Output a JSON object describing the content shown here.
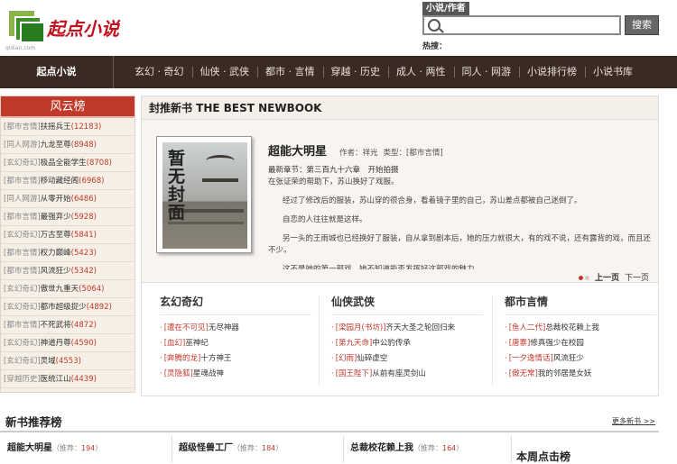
{
  "header": {
    "logo_text": "起点小说",
    "logo_sub": "qidian.com",
    "search_tab": "小说/作者",
    "search_value": "",
    "search_btn": "搜索",
    "hot_label": "热搜："
  },
  "nav": {
    "home": "起点小说",
    "items": [
      "玄幻 · 奇幻",
      "仙侠 · 武侠",
      "都市 · 言情",
      "穿越 · 历史",
      "成人 · 两性",
      "同人 · 网游",
      "小说排行榜",
      "小说书库"
    ]
  },
  "rank": {
    "title": "风云榜",
    "items": [
      {
        "cat": "[都市言情]",
        "name": "扶摇兵王",
        "votes": "(12183)"
      },
      {
        "cat": "[同人网游]",
        "name": "九龙至尊",
        "votes": "(8948)"
      },
      {
        "cat": "[玄幻奇幻]",
        "name": "极品全能学生",
        "votes": "(8708)"
      },
      {
        "cat": "[都市言情]",
        "name": "移动藏经阁",
        "votes": "(6968)"
      },
      {
        "cat": "[同人网游]",
        "name": "从零开始",
        "votes": "(6486)"
      },
      {
        "cat": "[都市言情]",
        "name": "最强弃少",
        "votes": "(5928)"
      },
      {
        "cat": "[玄幻奇幻]",
        "name": "万古至尊",
        "votes": "(5841)"
      },
      {
        "cat": "[都市言情]",
        "name": "权力巅峰",
        "votes": "(5423)"
      },
      {
        "cat": "[都市言情]",
        "name": "风流狂少",
        "votes": "(5342)"
      },
      {
        "cat": "[玄幻奇幻]",
        "name": "傲世九重天",
        "votes": "(5064)"
      },
      {
        "cat": "[玄幻奇幻]",
        "name": "都市超级捉少",
        "votes": "(4892)"
      },
      {
        "cat": "[都市言情]",
        "name": "不死武将",
        "votes": "(4872)"
      },
      {
        "cat": "[玄幻奇幻]",
        "name": "神道丹尊",
        "votes": "(4590)"
      },
      {
        "cat": "[玄幻奇幻]",
        "name": "灵域",
        "votes": "(4553)"
      },
      {
        "cat": "[穿越历史]",
        "name": "医统江山",
        "votes": "(4439)"
      }
    ]
  },
  "featured": {
    "title": "封推新书 THE BEST NEWBOOK",
    "cover_text": "暂无封面",
    "book_name": "超能大明星",
    "author_label": "作者：祥光",
    "type_label": "类型：[都市言情]",
    "latest": "最新章节：第三百九十六章　开始拍摄",
    "p1": "在张证荣的帮助下，苏山换好了戏服。",
    "p2": "经过了修改后的服装，苏山穿的很合身，看着镜子里的自己，苏山差点都被自己迷倒了。",
    "p3": "自恋的人往往就是这样。",
    "p4": "另一头的王雨城也已经换好了服装，自从拿到剧本后，她的压力就很大，有的戏不说，还有露背的戏，而且还不少。",
    "p5": "这不是她的第一部戏，她不知道能否发挥好这部戏的魅力",
    "prev": "上一页",
    "next": "下一页"
  },
  "cats": [
    {
      "title": "玄幻奇幻",
      "items": [
        {
          "tag": "[遭在不可见]",
          "title": "无尽神器"
        },
        {
          "tag": "[血幻]",
          "title": "巫神纪"
        },
        {
          "tag": "[奔腾的龙]",
          "title": "十方神王"
        },
        {
          "tag": "[灵隐狐]",
          "title": "星魂战神"
        }
      ]
    },
    {
      "title": "仙侠武侠",
      "items": [
        {
          "tag": "[梁园月(书坊)]",
          "title": "齐天大圣之轮回归来"
        },
        {
          "tag": "[第九天命]",
          "title": "中公豹传承"
        },
        {
          "tag": "[幻雨]",
          "title": "仙碎虚空"
        },
        {
          "tag": "[国王陛下]",
          "title": "从前有座灵剑山"
        }
      ]
    },
    {
      "title": "都市言情",
      "items": [
        {
          "tag": "[鱼人二代]",
          "title": "总裁校花赖上我"
        },
        {
          "tag": "[唐寨]",
          "title": "修真强少在校园"
        },
        {
          "tag": "[一夕逸情话]",
          "title": "风流狂少"
        },
        {
          "tag": "[傲无常]",
          "title": "我的邻居是女妖"
        }
      ]
    }
  ],
  "newbooks": {
    "title": "新书推荐榜",
    "more": "更多新书 >>",
    "rec_label": "推荐：",
    "items": [
      {
        "name": "超能大明星",
        "votes": "194"
      },
      {
        "name": "超级怪兽工厂",
        "votes": "184"
      },
      {
        "name": "总裁校花赖上我",
        "votes": "164"
      }
    ],
    "week_title": "本周点击榜"
  }
}
